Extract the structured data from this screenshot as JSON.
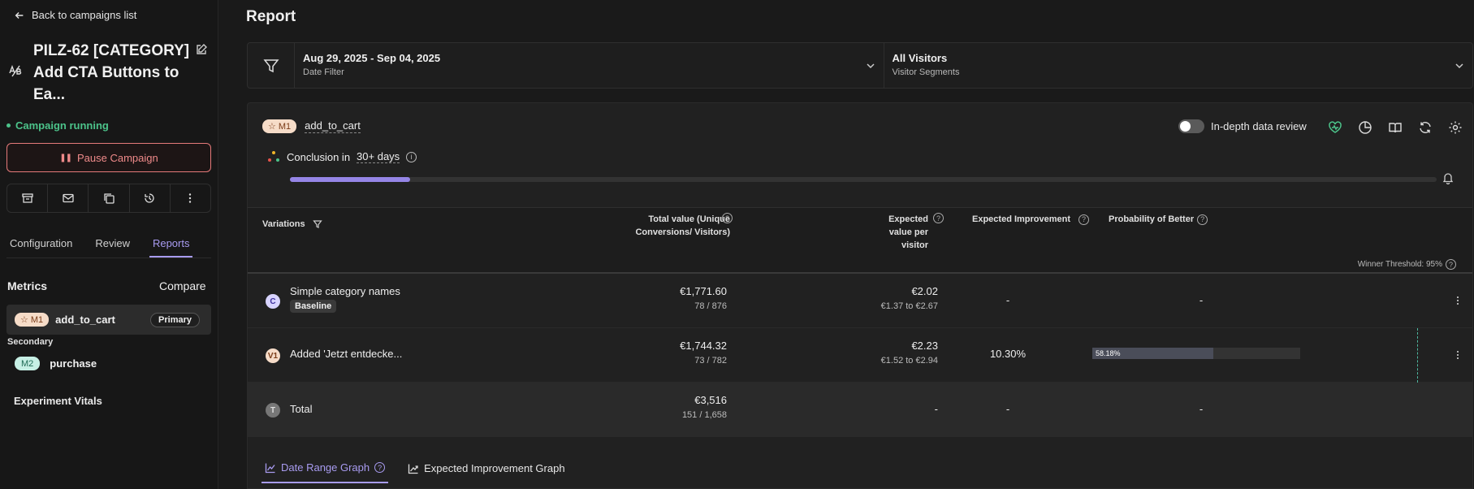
{
  "sidebar": {
    "back_label": "Back to campaigns list",
    "campaign_title": "PILZ-62 [CATEGORY] Add CTA Buttons to Ea...",
    "status": "Campaign running",
    "pause_label": "Pause Campaign",
    "tabs": [
      "Configuration",
      "Review",
      "Reports"
    ],
    "metrics_heading": "Metrics",
    "compare_label": "Compare",
    "primary_metric": {
      "badge": "M1",
      "name": "add_to_cart",
      "tag": "Primary"
    },
    "secondary_heading": "Secondary",
    "secondary_metric": {
      "badge": "M2",
      "name": "purchase"
    },
    "vitals_label": "Experiment Vitals"
  },
  "main": {
    "title": "Report",
    "date_filter": {
      "value": "Aug 29, 2025 - Sep 04, 2025",
      "label": "Date Filter"
    },
    "segment_filter": {
      "value": "All Visitors",
      "label": "Visitor Segments"
    },
    "metric": {
      "badge": "M1",
      "name": "add_to_cart"
    },
    "toggle_label": "In-depth data review",
    "conclusion_prefix": "Conclusion in",
    "conclusion_days": "30+ days",
    "progress": 0.105,
    "table": {
      "headers": {
        "variations": "Variations",
        "total_value": "Total value (Unique Conversions/ Visitors)",
        "expected_value": "Expected value per visitor",
        "expected_improvement": "Expected Improvement",
        "probability": "Probability of Better"
      },
      "winner_threshold": "Winner Threshold: 95%",
      "rows": [
        {
          "badge": "C",
          "name": "Simple category names",
          "tag": "Baseline",
          "total": "€1,771.60",
          "ratio": "78 / 876",
          "expected": "€2.02",
          "range": "€1.37 to €2.67",
          "improvement": "-",
          "probability": "-"
        },
        {
          "badge": "V1",
          "name": "Added 'Jetzt entdecke...",
          "total": "€1,744.32",
          "ratio": "73 / 782",
          "expected": "€2.23",
          "range": "€1.52 to €2.94",
          "improvement": "10.30%",
          "probability": "58.18%",
          "probability_value": 0.5818
        },
        {
          "badge": "T",
          "name": "Total",
          "total": "€3,516",
          "ratio": "151 / 1,658",
          "expected": "-",
          "improvement": "-",
          "probability": "-"
        }
      ]
    },
    "graph_tabs": [
      "Date Range Graph",
      "Expected Improvement Graph"
    ]
  },
  "colors": {
    "accent": "#a89bf0",
    "running": "#4cc38a",
    "pause": "#e57a7a",
    "threshold": "#4fb7a0"
  }
}
